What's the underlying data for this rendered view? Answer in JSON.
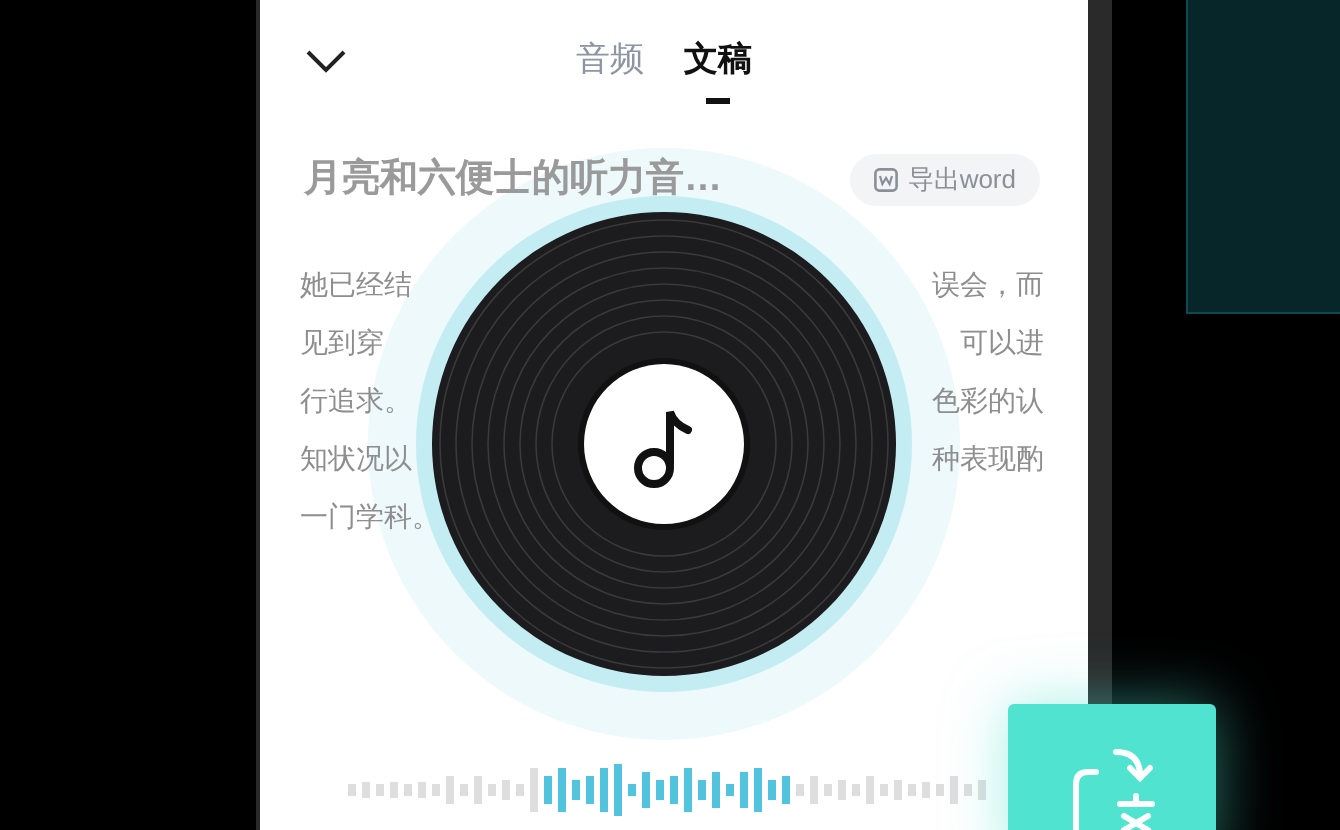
{
  "header": {
    "tabs": [
      {
        "label": "音频",
        "selected": false
      },
      {
        "label": "文稿",
        "selected": true
      }
    ]
  },
  "document": {
    "title": "月亮和六便士的听力音…",
    "export_button": "导出word",
    "lines": [
      {
        "start": "她已经结",
        "end": "误会，而"
      },
      {
        "start": "见到穿",
        "end": "可以进"
      },
      {
        "start": "行追求。",
        "end": "色彩的认"
      },
      {
        "start": "知状况以",
        "end": "种表现酌"
      },
      {
        "start": "一门学科。"
      }
    ]
  }
}
